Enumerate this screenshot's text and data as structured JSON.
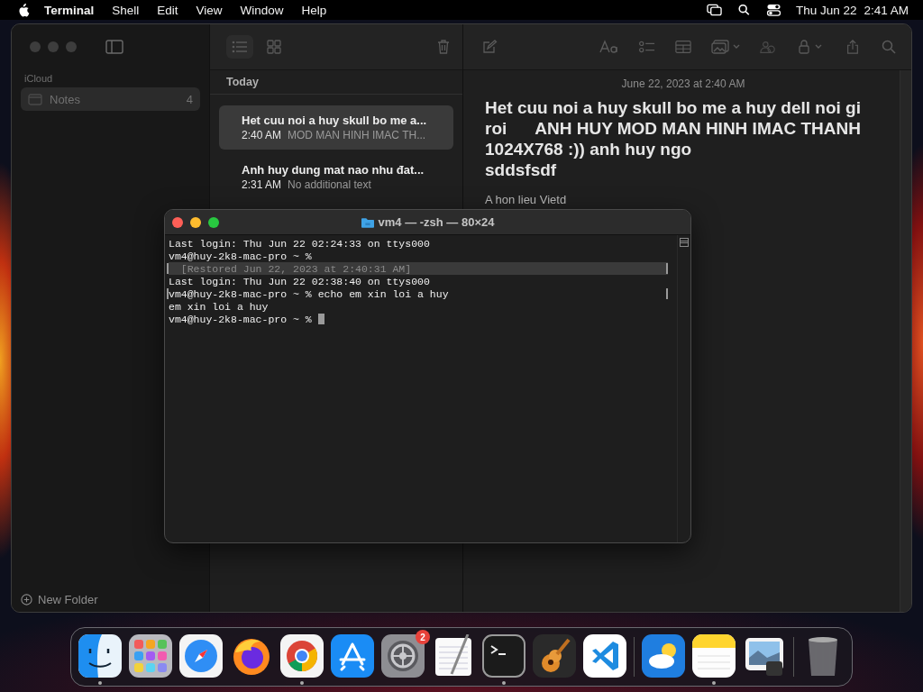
{
  "menu_bar": {
    "app_name": "Terminal",
    "menus": [
      "Shell",
      "Edit",
      "View",
      "Window",
      "Help"
    ],
    "date": "Thu Jun 22",
    "time": "2:41 AM"
  },
  "notes_window": {
    "sidebar": {
      "section": "iCloud",
      "folders": [
        {
          "name": "Notes",
          "count": "4",
          "selected": true
        }
      ],
      "new_folder": "New Folder"
    },
    "note_list": {
      "group": "Today",
      "notes": [
        {
          "title": "Het cuu noi a huy skull bo me a...",
          "time": "2:40 AM",
          "preview": "MOD MAN HINH IMAC TH...",
          "selected": true
        },
        {
          "title": "Anh huy dung mat nao nhu đat...",
          "time": "2:31 AM",
          "preview": "No additional text",
          "selected": false
        }
      ]
    },
    "editor": {
      "date": "June 22, 2023 at 2:40 AM",
      "heading_lines": [
        "Het cuu noi a huy skull bo me a huy dell noi gi",
        "roi      ANH HUY MOD MAN HINH IMAC THANH",
        "1024X768 :)) anh huy ngo",
        "sddsfsdf"
      ],
      "body": "A hon lieu Vietd"
    }
  },
  "terminal": {
    "title": "vm4 — -zsh — 80×24",
    "lines": [
      {
        "kind": "output",
        "text": "Last login: Thu Jun 22 02:24:33 on ttys000",
        "marked": false,
        "cursor": false
      },
      {
        "kind": "output",
        "text": "vm4@huy-2k8-mac-pro ~ %",
        "marked": false,
        "cursor": false
      },
      {
        "kind": "restored",
        "text": "  [Restored Jun 22, 2023 at 2:40:31 AM]",
        "marked": true,
        "cursor": false
      },
      {
        "kind": "output",
        "text": "Last login: Thu Jun 22 02:38:40 on ttys000",
        "marked": false,
        "cursor": false
      },
      {
        "kind": "output",
        "text": "vm4@huy-2k8-mac-pro ~ % echo em xin loi a huy",
        "marked": true,
        "cursor": false
      },
      {
        "kind": "output",
        "text": "em xin loi a huy",
        "marked": false,
        "cursor": false
      },
      {
        "kind": "output",
        "text": "vm4@huy-2k8-mac-pro ~ %",
        "marked": false,
        "cursor": true
      }
    ]
  },
  "dock": {
    "groups": [
      {
        "apps": [
          {
            "kind": "finder",
            "running": true
          },
          {
            "kind": "launchpad",
            "running": false
          },
          {
            "kind": "safari",
            "running": false
          },
          {
            "kind": "firefox",
            "running": false
          },
          {
            "kind": "chrome",
            "running": true
          },
          {
            "kind": "appstore",
            "running": false
          },
          {
            "kind": "settings",
            "running": false,
            "badge": "2"
          },
          {
            "kind": "textedit",
            "running": false
          },
          {
            "kind": "terminal",
            "running": true
          },
          {
            "kind": "garageband",
            "running": false
          },
          {
            "kind": "vscode",
            "running": false
          }
        ]
      },
      {
        "apps": [
          {
            "kind": "weather",
            "running": false
          },
          {
            "kind": "notes",
            "running": true
          },
          {
            "kind": "preview",
            "running": false
          }
        ]
      },
      {
        "apps": [
          {
            "kind": "trash",
            "running": false
          }
        ]
      }
    ]
  }
}
